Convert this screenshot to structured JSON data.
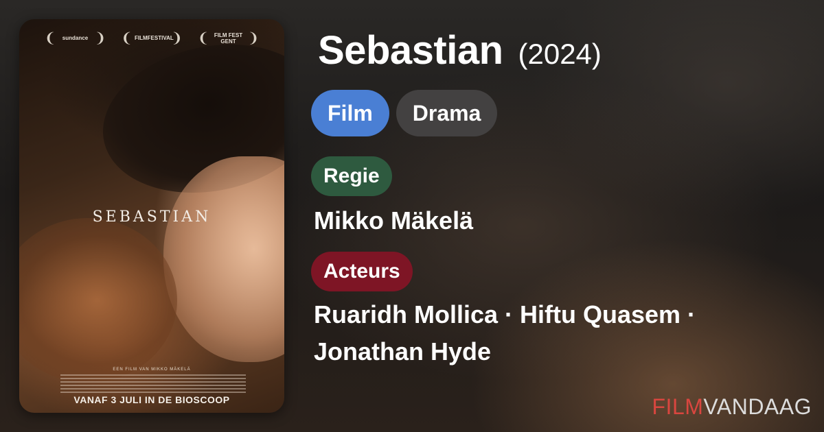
{
  "poster": {
    "festivals": [
      "sundance",
      "FILMFESTIVAL",
      "FILM FEST GENT"
    ],
    "title": "SEBASTIAN",
    "credit": "EEN FILM VAN MIKKO MÄKELÄ",
    "release": "VANAF 3 JULI IN DE BIOSCOOP"
  },
  "movie": {
    "title": "Sebastian",
    "year": "(2024)"
  },
  "tags": {
    "type": "Film",
    "genre": "Drama"
  },
  "regie": {
    "label": "Regie",
    "name": "Mikko Mäkelä"
  },
  "acteurs": {
    "label": "Acteurs",
    "line1": "Ruaridh Mollica · Hiftu Quasem ·",
    "line2": "Jonathan Hyde"
  },
  "brand": {
    "part1": "FILM",
    "part2": "VANDAAG",
    "color_accent": "#d9463f"
  },
  "colors": {
    "film_tag": "#4a7fd4",
    "genre_tag": "#434141",
    "regie_tag": "#2e5a3f",
    "acteurs_tag": "#7e1525"
  }
}
